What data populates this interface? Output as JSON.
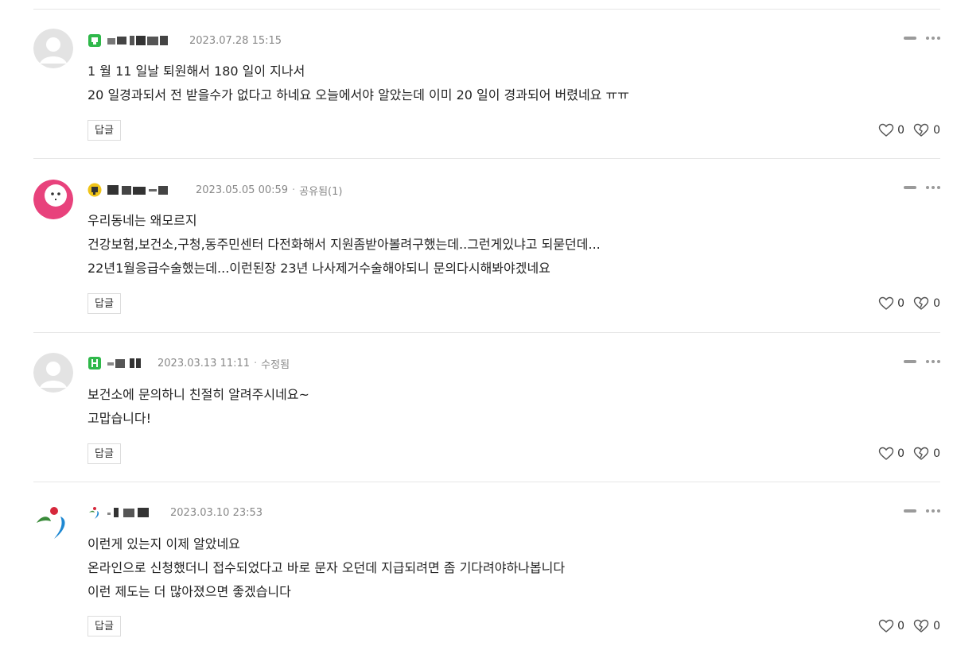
{
  "comments": [
    {
      "date": "2023.07.28 15:15",
      "extra": "",
      "lines": [
        "1 월 11 일날 퇴원해서 180 일이 지나서",
        "20 일경과되서 전 받을수가 없다고 하네요 오늘에서야 알았는데 이미 20 일이 경과되어 버렸네요 ㅠㅠ"
      ],
      "reply_label": "답글",
      "likes": "0",
      "dislikes": "0",
      "avatar_icon": "default-avatar-icon",
      "badge_color": "#2fb84a"
    },
    {
      "date": "2023.05.05 00:59",
      "extra": "공유됨(1)",
      "lines": [
        "우리동네는 왜모르지",
        "건강보험,보건소,구청,동주민센터 다전화해서 지원좀받아볼려구했는데..그런게있냐고 되묻던데...",
        "22년1월응급수술했는데...이런된장 23년 나사제거수술해야되니 문의다시해봐야겠네요"
      ],
      "reply_label": "답글",
      "likes": "0",
      "dislikes": "0",
      "avatar_icon": "pink-face-avatar-icon",
      "badge_color": "#f0c419"
    },
    {
      "date": "2023.03.13 11:11",
      "extra": "수정됨",
      "lines": [
        "보건소에 문의하니 친절히 알려주시네요~",
        "고맙습니다!"
      ],
      "reply_label": "답글",
      "likes": "0",
      "dislikes": "0",
      "avatar_icon": "default-avatar-icon",
      "badge_color": "#2fb84a"
    },
    {
      "date": "2023.03.10 23:53",
      "extra": "",
      "lines": [
        "이런게 있는지 이제 알았네요",
        "온라인으로 신청했더니 접수되었다고 바로 문자 오던데 지급되려면 좀 기다려야하나봅니다",
        "이런 제도는 더 많아졌으면 좋겠습니다"
      ],
      "reply_label": "답글",
      "likes": "0",
      "dislikes": "0",
      "avatar_icon": "seoul-logo-avatar-icon",
      "badge_color": "#d6283c"
    }
  ]
}
